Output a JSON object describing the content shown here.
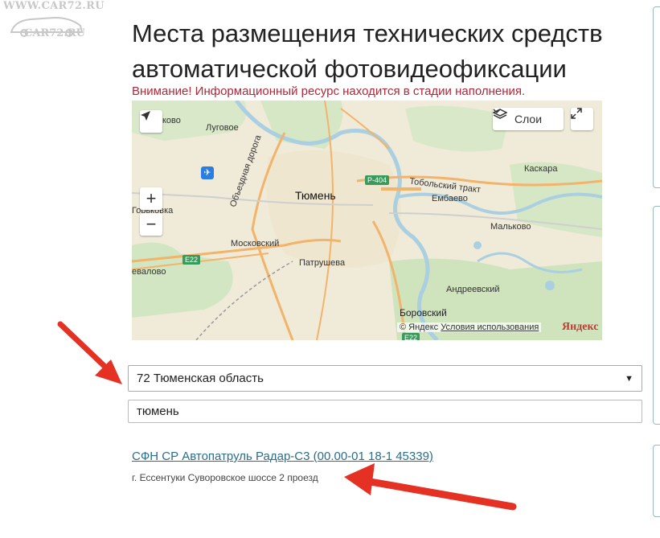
{
  "watermark": {
    "line1": "WWW.CAR72.RU",
    "line2": "CAR72.RU"
  },
  "page": {
    "title": "Места размещения технических средств автоматической фотовидеофиксации",
    "notice": "Внимание! Информационный ресурс находится в стадии наполнения."
  },
  "map": {
    "labels": {
      "city": "Тюмень",
      "lugovoe": "Луговое",
      "kovo": "ково",
      "gorkovka": "Горьковка",
      "moskovskiy": "Московский",
      "evalovo": "евалово",
      "patrusheva": "Патрушева",
      "obezdnaya": "Объездная дорога",
      "tobolskiy": "Тобольский тракт",
      "embaevo": "Ембаево",
      "kaskara": "Каскара",
      "malkovo": "Мальково",
      "andreevskiy": "Андреевский",
      "borovskiy": "Боровский"
    },
    "road_signs": {
      "r404": "Р-404",
      "e22a": "E22",
      "e22b": "E22"
    },
    "controls": {
      "layers_label": "Слои"
    },
    "footer": {
      "copyright": "© Яндекс",
      "terms": "Условия использования",
      "logo": "Яндекс"
    }
  },
  "filters": {
    "region_selected": "72 Тюменская область",
    "city_value": "тюмень"
  },
  "results": [
    {
      "title": "СФН СР Автопатруль Радар-С3 (00.00-01 18-1 45339)",
      "address": "г. Ессентуки Суворовское шоссе 2 проезд"
    }
  ],
  "colors": {
    "accent_link": "#2c6d8c",
    "notice": "#b0283a",
    "annotation_arrow": "#e53024"
  },
  "icons": {
    "locate": "navigation-arrow-icon",
    "layers": "layers-icon",
    "fullscreen": "expand-icon",
    "select": "caret-down-icon"
  }
}
